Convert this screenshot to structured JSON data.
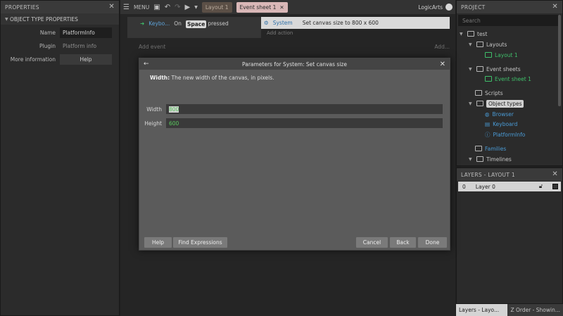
{
  "properties": {
    "header": "PROPERTIES",
    "section": "OBJECT TYPE PROPERTIES",
    "rows": [
      {
        "label": "Name",
        "value": "PlatformInfo"
      },
      {
        "label": "Plugin",
        "value": "Platform info"
      },
      {
        "label": "More information",
        "value": "Help"
      }
    ]
  },
  "toolbar": {
    "menu_label": "MENU",
    "tabs": [
      {
        "label": "Layout 1"
      },
      {
        "label": "Event sheet 1"
      }
    ],
    "brand": "LogicArts"
  },
  "event": {
    "cond_object": "Keybo...",
    "cond_on": "On",
    "cond_key": "Space",
    "cond_rest": "pressed",
    "action_object": "System",
    "action_text": "Set canvas size to 800 x 600",
    "add_action": "Add action",
    "add_event": "Add event",
    "add_right": "Add..."
  },
  "project": {
    "header": "PROJECT",
    "search_placeholder": "Search",
    "root": "test",
    "layouts": "Layouts",
    "layout1": "Layout 1",
    "event_sheets": "Event sheets",
    "event_sheet1": "Event sheet 1",
    "scripts": "Scripts",
    "object_types": "Object types",
    "objects": [
      "Browser",
      "Keyboard",
      "PlatformInfo"
    ],
    "families": "Families",
    "timelines": "Timelines"
  },
  "layers": {
    "header": "LAYERS - LAYOUT 1",
    "row_index": "0",
    "row_name": "Layer 0"
  },
  "bottom_tabs": [
    "Layers - Layo...",
    "Z Order - Showin..."
  ],
  "dialog": {
    "title": "Parameters for System: Set canvas size",
    "desc_bold": "Width:",
    "desc": " The new width of the canvas, in pixels.",
    "width_label": "Width",
    "width_value": "800",
    "height_label": "Height",
    "height_value": "600",
    "buttons": {
      "help": "Help",
      "find": "Find Expressions",
      "cancel": "Cancel",
      "back": "Back",
      "done": "Done"
    }
  }
}
